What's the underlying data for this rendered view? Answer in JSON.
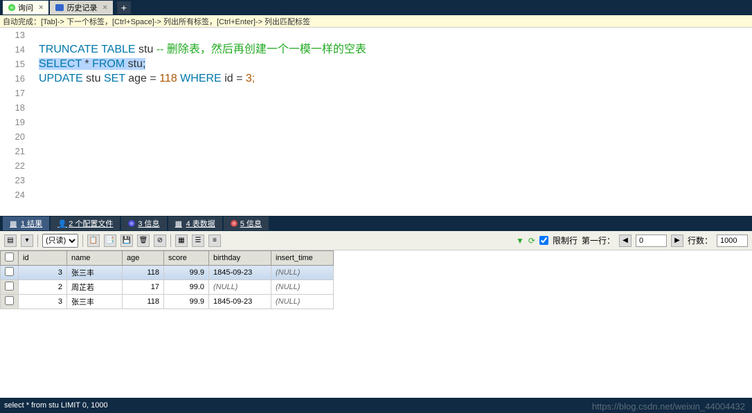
{
  "topTabs": {
    "tab1": "询问",
    "tab2": "历史记录"
  },
  "hint": "自动完成：[Tab]-> 下一个标签，[Ctrl+Space]-> 列出所有标签，[Ctrl+Enter]-> 列出匹配标签",
  "editor": {
    "lines": [
      "13",
      "14",
      "15",
      "16",
      "17",
      "18",
      "19",
      "20",
      "21",
      "22",
      "23",
      "24"
    ],
    "line14_kw1": "TRUNCATE",
    "line14_kw2": "TABLE",
    "line14_id": "stu",
    "line14_cmt": "-- 删除表，然后再创建一个一模一样的空表",
    "line16_kw1": "SELECT",
    "line16_star": "*",
    "line16_kw2": "FROM",
    "line16_id": "stu;",
    "line20_kw1": "UPDATE",
    "line20_id1": "stu",
    "line20_kw2": "SET",
    "line20_id2": "age",
    "line20_eq1": "=",
    "line20_num1": "118",
    "line20_kw3": "WHERE",
    "line20_id3": "id",
    "line20_eq2": "=",
    "line20_num2": "3;"
  },
  "bottomTabs": {
    "results": "1 结果",
    "profiles": "2 个配置文件",
    "info3": "3 信息",
    "tabledata": "4 表数据",
    "info5": "5 信息"
  },
  "toolbar": {
    "mode_label": "(只读)",
    "limit_check_label": "限制行",
    "firstrow_label": "第一行：",
    "firstrow_value": "0",
    "rowcount_label": "行数：",
    "rowcount_value": "1000"
  },
  "table": {
    "headers": {
      "id": "id",
      "name": "name",
      "age": "age",
      "score": "score",
      "birthday": "birthday",
      "insert_time": "insert_time"
    },
    "rows": [
      {
        "id": "3",
        "name": "张三丰",
        "age": "118",
        "score": "99.9",
        "birthday": "1845-09-23",
        "insert_time": "(NULL)",
        "selected": true
      },
      {
        "id": "2",
        "name": "周芷若",
        "age": "17",
        "score": "99.0",
        "birthday": "(NULL)",
        "insert_time": "(NULL)",
        "selected": false
      },
      {
        "id": "3",
        "name": "张三丰",
        "age": "118",
        "score": "99.9",
        "birthday": "1845-09-23",
        "insert_time": "(NULL)",
        "selected": false
      }
    ]
  },
  "status": "select * from stu LIMIT 0, 1000",
  "watermark": "https://blog.csdn.net/weixin_44004432"
}
